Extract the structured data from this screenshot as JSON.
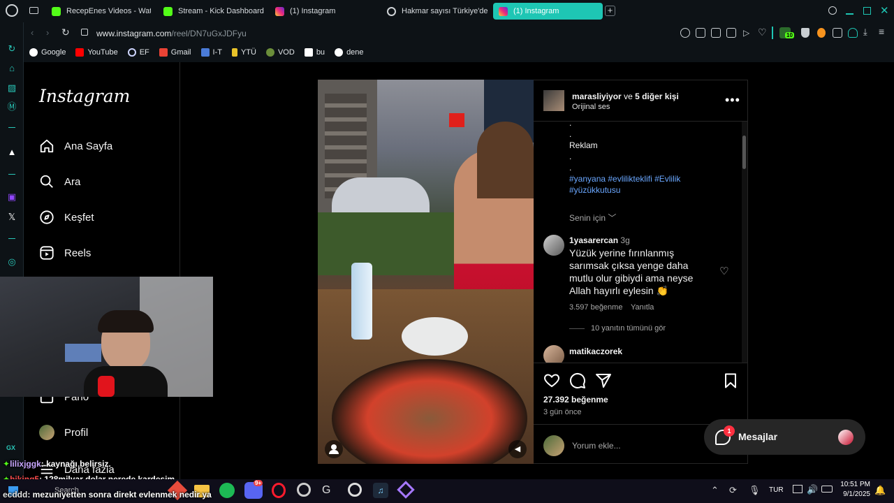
{
  "tabs": [
    {
      "label": "RecepEnes Videos - Watc",
      "icon": "kick-icon"
    },
    {
      "label": "Stream - Kick Dashboard",
      "icon": "kick-icon"
    },
    {
      "label": "(1) Instagram",
      "icon": "instagram-icon"
    },
    {
      "label": "Hakmar sayısı Türkiye'de",
      "icon": "gear-icon"
    },
    {
      "label": "(1) Instagram",
      "icon": "instagram-icon"
    }
  ],
  "address": {
    "url_host": "www.instagram.com",
    "url_path": "/reel/DN7uGxJDFyu"
  },
  "bookmarks": [
    "Google",
    "YouTube",
    "EF",
    "Gmail",
    "I-T",
    "YTÜ",
    "VOD",
    "bu",
    "dene"
  ],
  "extension_badge": "10",
  "instagram": {
    "logo": "Instagram",
    "nav": [
      "Ana Sayfa",
      "Ara",
      "Keşfet",
      "Reels",
      "Pano",
      "Profil",
      "Daha fazla"
    ],
    "post": {
      "author": "marasliyiyor",
      "collab_text": "ve",
      "collab_count": "5 diğer kişi",
      "audio": "Orijinal ses",
      "caption_dots": ".",
      "caption_word": "Reklam",
      "hashtags_line1": "#yanyana #evlilikteklifi #Evlilik",
      "hashtags_line2": "#yüzükkutusu",
      "for_you": "Senin için",
      "comments": [
        {
          "user": "1yasarercan",
          "age": "3g",
          "text": "Yüzük yerine fırınlanmış sarımsak çıksa yenge daha mutlu olur gibiydi ama neyse Allah hayırlı eylesin 👏",
          "likes": "3.597 beğenme",
          "reply": "Yanıtla",
          "view_replies": "10 yanıtın tümünü gör"
        },
        {
          "user": "matikaczorek"
        }
      ],
      "likes": "27.392 beğenme",
      "time": "3 gün önce",
      "comment_placeholder": "Yorum ekle..."
    },
    "messages_label": "Mesajlar",
    "messages_badge": "1"
  },
  "chat_overlay": [
    {
      "user": "lilixjggk",
      "text": ": kaynağı belirsiz."
    },
    {
      "user": "hiking5",
      "text": ": 128milyar dolar nerede kardeşim"
    },
    {
      "user": "ecddd",
      "text": ": mezuniyetten sonra direkt evlenmek nedir ya"
    }
  ],
  "gx_label": "GX",
  "taskbar": {
    "search": "Search",
    "lang": "TUR",
    "time": "10:51 PM",
    "date": "9/1/2025",
    "discord_badge": "9+"
  },
  "colors": {
    "accent": "#1ec6b4",
    "kick": "#53fc18",
    "link": "#6aa7ff",
    "badge": "#ff3040"
  }
}
